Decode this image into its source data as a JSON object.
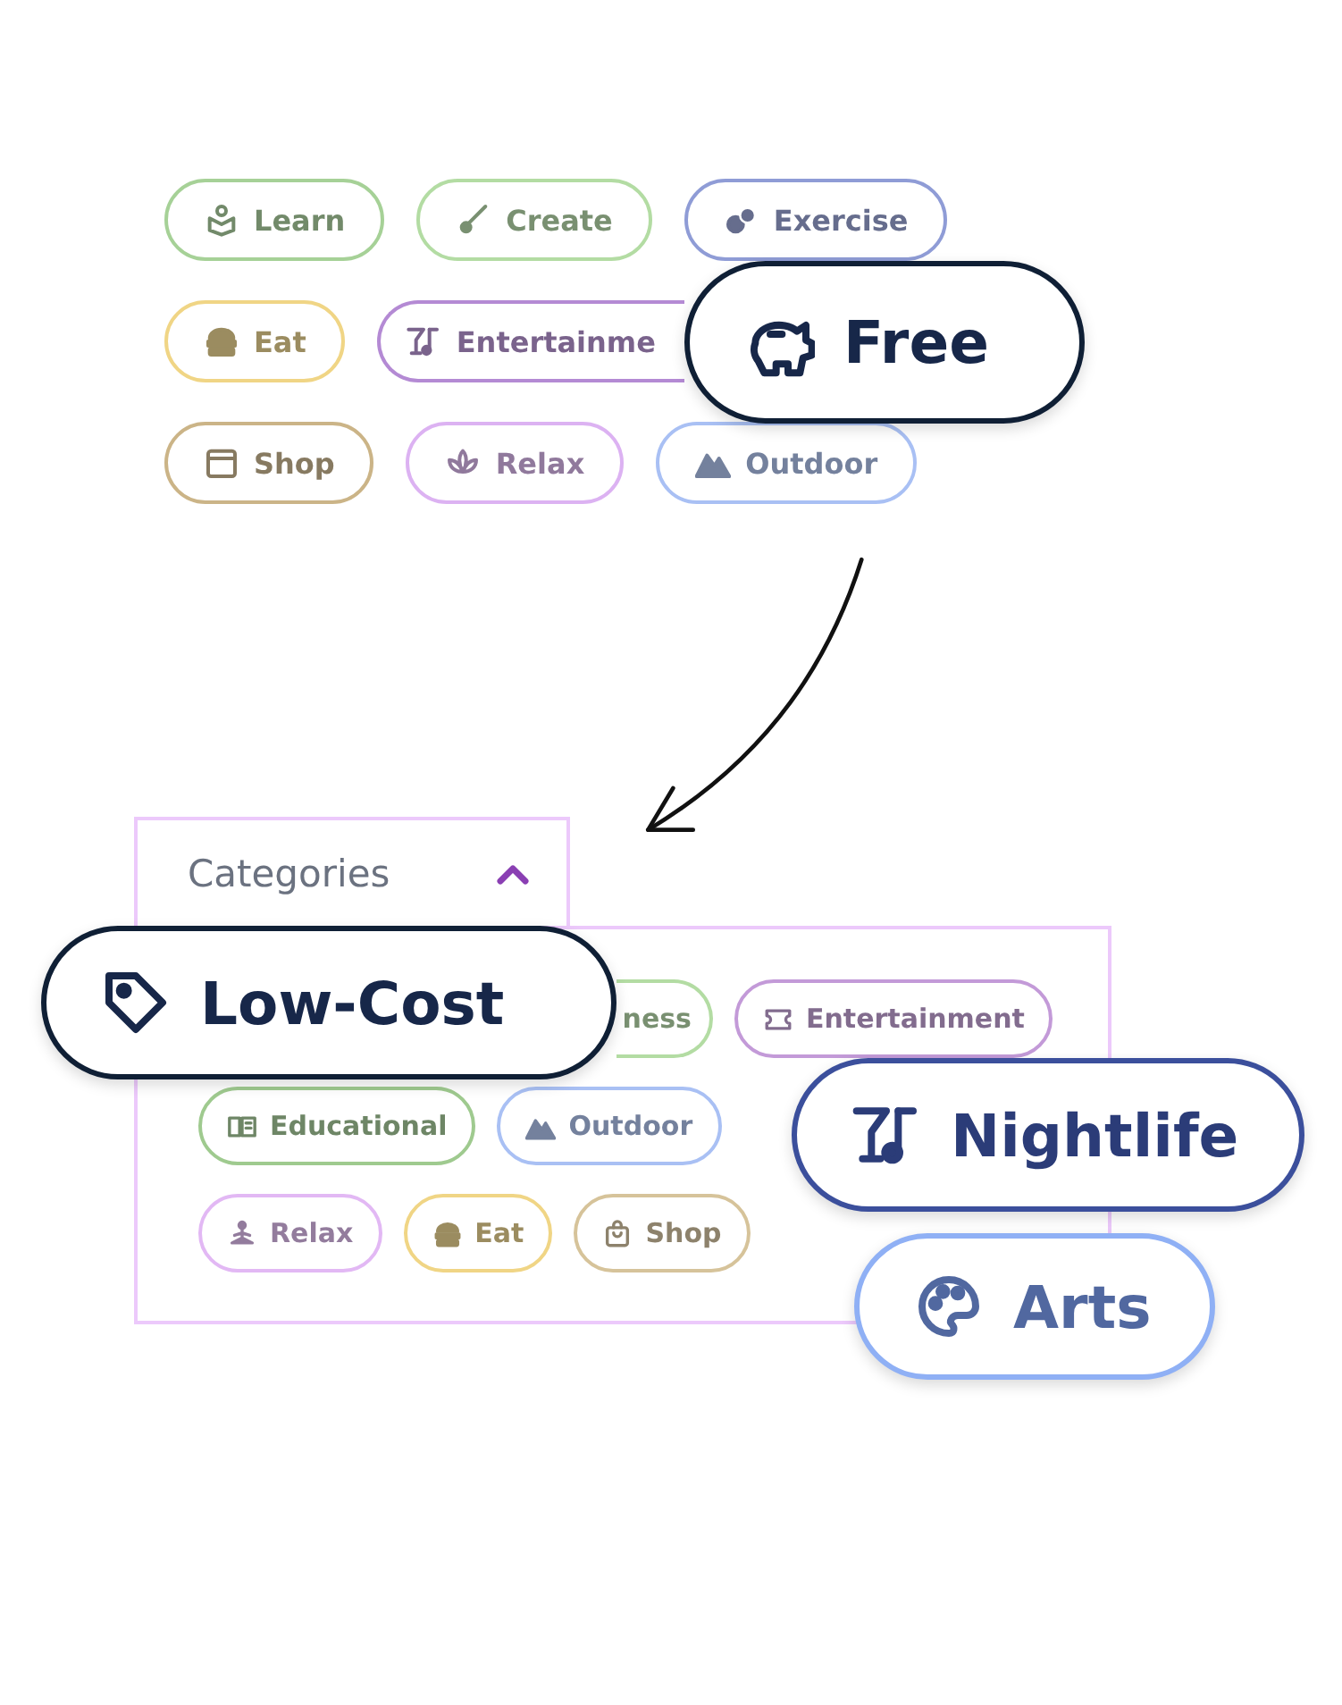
{
  "top_tags": [
    [
      {
        "label": "Learn",
        "color": "#a6d197"
      },
      {
        "label": "Create",
        "color": "#b3dca3"
      },
      {
        "label": "Exercise",
        "color": "#8f9cd6"
      }
    ],
    [
      {
        "label": "Eat",
        "color": "#f0d585"
      },
      {
        "label": "Entertainme",
        "color": "#b48ad4"
      }
    ],
    [
      {
        "label": "Shop",
        "color": "#cbb487"
      },
      {
        "label": "Relax",
        "color": "#dcb2f2"
      },
      {
        "label": "Outdoor",
        "color": "#a9c0f4"
      }
    ]
  ],
  "categories": {
    "title": "Categories",
    "expanded": true,
    "tags": [
      [
        {
          "label": "ness",
          "color": "#b3dca3"
        },
        {
          "label": "Entertainment",
          "color": "#c39ad8"
        }
      ],
      [
        {
          "label": "Educational",
          "color": "#9fca8f"
        },
        {
          "label": "Outdoor",
          "color": "#a9c0f4"
        }
      ],
      [
        {
          "label": "Relax",
          "color": "#e2b8f4"
        },
        {
          "label": "Eat",
          "color": "#f0d585"
        },
        {
          "label": "Shop",
          "color": "#d6c39a"
        }
      ]
    ]
  },
  "focus_tags": [
    {
      "label": "Free",
      "color": "#0f1f35"
    },
    {
      "label": "Low-Cost",
      "color": "#0f1f35"
    },
    {
      "label": "Nightlife",
      "color": "#3b4f9c"
    },
    {
      "label": "Arts",
      "color": "#8fb0f5"
    }
  ]
}
